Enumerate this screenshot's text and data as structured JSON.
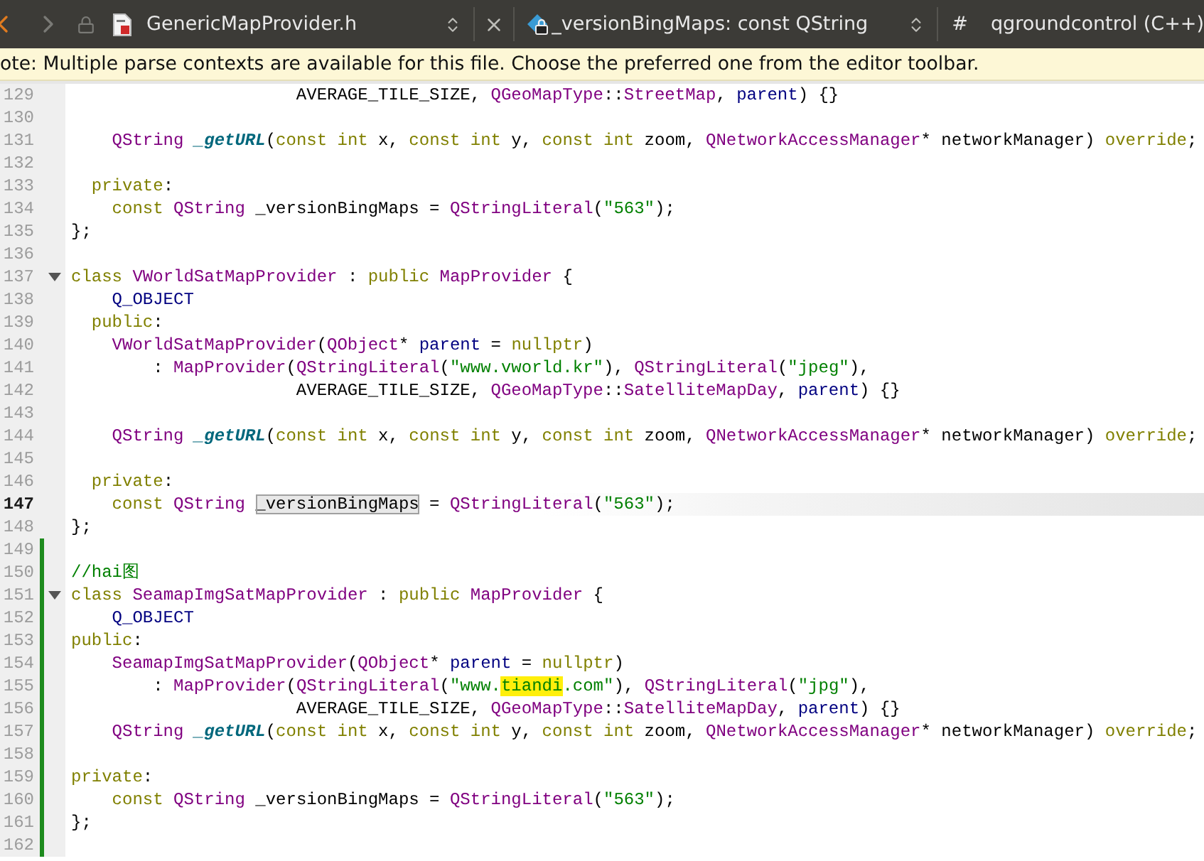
{
  "toolbar": {
    "file_name": "GenericMapProvider.h",
    "symbol": "_versionBingMaps: const QString",
    "project_marker": "#",
    "project": "qgroundcontrol (C++)"
  },
  "notice": "ote: Multiple parse contexts are available for this file. Choose the preferred one from the editor toolbar.",
  "lines": [
    {
      "number": "129",
      "current": false,
      "changed": false,
      "foldable": false,
      "tokens": [
        {
          "kind": "plain",
          "text": "                      AVERAGE_TILE_SIZE, "
        },
        {
          "kind": "type",
          "text": "QGeoMapType"
        },
        {
          "kind": "plain",
          "text": "::"
        },
        {
          "kind": "type",
          "text": "StreetMap"
        },
        {
          "kind": "plain",
          "text": ", "
        },
        {
          "kind": "member",
          "text": "parent"
        },
        {
          "kind": "plain",
          "text": ") {}"
        }
      ]
    },
    {
      "number": "130",
      "current": false,
      "changed": false,
      "foldable": false
    },
    {
      "number": "131",
      "current": false,
      "changed": false,
      "foldable": false,
      "tokens": [
        {
          "kind": "type",
          "text": "    QString "
        },
        {
          "kind": "fn",
          "text": "_getURL"
        },
        {
          "kind": "plain",
          "text": "("
        },
        {
          "kind": "kw",
          "text": "const int"
        },
        {
          "kind": "plain",
          "text": " x, "
        },
        {
          "kind": "kw",
          "text": "const int"
        },
        {
          "kind": "plain",
          "text": " y, "
        },
        {
          "kind": "kw",
          "text": "const int"
        },
        {
          "kind": "plain",
          "text": " zoom, "
        },
        {
          "kind": "type",
          "text": "QNetworkAccessManager"
        },
        {
          "kind": "plain",
          "text": "* networkManager) "
        },
        {
          "kind": "kw",
          "text": "override"
        },
        {
          "kind": "plain",
          "text": ";"
        }
      ]
    },
    {
      "number": "132",
      "current": false,
      "changed": false,
      "foldable": false
    },
    {
      "number": "133",
      "current": false,
      "changed": false,
      "foldable": false,
      "tokens": [
        {
          "kind": "kw",
          "text": "  private"
        },
        {
          "kind": "plain",
          "text": ":"
        }
      ]
    },
    {
      "number": "134",
      "current": false,
      "changed": false,
      "foldable": false,
      "tokens": [
        {
          "kind": "kw",
          "text": "    const "
        },
        {
          "kind": "type",
          "text": "QString"
        },
        {
          "kind": "plain",
          "text": " _versionBingMaps = "
        },
        {
          "kind": "type",
          "text": "QStringLiteral"
        },
        {
          "kind": "plain",
          "text": "("
        },
        {
          "kind": "str",
          "text": "\"563\""
        },
        {
          "kind": "plain",
          "text": ");"
        }
      ]
    },
    {
      "number": "135",
      "current": false,
      "changed": false,
      "foldable": false,
      "tokens": [
        {
          "kind": "plain",
          "text": "};"
        }
      ]
    },
    {
      "number": "136",
      "current": false,
      "changed": false,
      "foldable": false
    },
    {
      "number": "137",
      "current": false,
      "changed": false,
      "foldable": true,
      "tokens": [
        {
          "kind": "kw",
          "text": "class "
        },
        {
          "kind": "type",
          "text": "VWorldSatMapProvider"
        },
        {
          "kind": "plain",
          "text": " : "
        },
        {
          "kind": "kw",
          "text": "public "
        },
        {
          "kind": "type",
          "text": "MapProvider"
        },
        {
          "kind": "plain",
          "text": " {"
        }
      ]
    },
    {
      "number": "138",
      "current": false,
      "changed": false,
      "foldable": false,
      "tokens": [
        {
          "kind": "member",
          "text": "    Q_OBJECT"
        }
      ]
    },
    {
      "number": "139",
      "current": false,
      "changed": false,
      "foldable": false,
      "tokens": [
        {
          "kind": "kw",
          "text": "  public"
        },
        {
          "kind": "plain",
          "text": ":"
        }
      ]
    },
    {
      "number": "140",
      "current": false,
      "changed": false,
      "foldable": false,
      "tokens": [
        {
          "kind": "type",
          "text": "    VWorldSatMapProvider"
        },
        {
          "kind": "plain",
          "text": "("
        },
        {
          "kind": "type",
          "text": "QObject"
        },
        {
          "kind": "plain",
          "text": "* "
        },
        {
          "kind": "member",
          "text": "parent"
        },
        {
          "kind": "plain",
          "text": " = "
        },
        {
          "kind": "kw",
          "text": "nullptr"
        },
        {
          "kind": "plain",
          "text": ")"
        }
      ]
    },
    {
      "number": "141",
      "current": false,
      "changed": false,
      "foldable": false,
      "tokens": [
        {
          "kind": "plain",
          "text": "        : "
        },
        {
          "kind": "type",
          "text": "MapProvider"
        },
        {
          "kind": "plain",
          "text": "("
        },
        {
          "kind": "type",
          "text": "QStringLiteral"
        },
        {
          "kind": "plain",
          "text": "("
        },
        {
          "kind": "str",
          "text": "\"www.vworld.kr\""
        },
        {
          "kind": "plain",
          "text": "), "
        },
        {
          "kind": "type",
          "text": "QStringLiteral"
        },
        {
          "kind": "plain",
          "text": "("
        },
        {
          "kind": "str",
          "text": "\"jpeg\""
        },
        {
          "kind": "plain",
          "text": "),"
        }
      ]
    },
    {
      "number": "142",
      "current": false,
      "changed": false,
      "foldable": false,
      "tokens": [
        {
          "kind": "plain",
          "text": "                      AVERAGE_TILE_SIZE, "
        },
        {
          "kind": "type",
          "text": "QGeoMapType"
        },
        {
          "kind": "plain",
          "text": "::"
        },
        {
          "kind": "type",
          "text": "SatelliteMapDay"
        },
        {
          "kind": "plain",
          "text": ", "
        },
        {
          "kind": "member",
          "text": "parent"
        },
        {
          "kind": "plain",
          "text": ") {}"
        }
      ]
    },
    {
      "number": "143",
      "current": false,
      "changed": false,
      "foldable": false
    },
    {
      "number": "144",
      "current": false,
      "changed": false,
      "foldable": false,
      "tokens": [
        {
          "kind": "type",
          "text": "    QString "
        },
        {
          "kind": "fn",
          "text": "_getURL"
        },
        {
          "kind": "plain",
          "text": "("
        },
        {
          "kind": "kw",
          "text": "const int"
        },
        {
          "kind": "plain",
          "text": " x, "
        },
        {
          "kind": "kw",
          "text": "const int"
        },
        {
          "kind": "plain",
          "text": " y, "
        },
        {
          "kind": "kw",
          "text": "const int"
        },
        {
          "kind": "plain",
          "text": " zoom, "
        },
        {
          "kind": "type",
          "text": "QNetworkAccessManager"
        },
        {
          "kind": "plain",
          "text": "* networkManager) "
        },
        {
          "kind": "kw",
          "text": "override"
        },
        {
          "kind": "plain",
          "text": ";"
        }
      ]
    },
    {
      "number": "145",
      "current": false,
      "changed": false,
      "foldable": false
    },
    {
      "number": "146",
      "current": false,
      "changed": false,
      "foldable": false,
      "tokens": [
        {
          "kind": "kw",
          "text": "  private"
        },
        {
          "kind": "plain",
          "text": ":"
        }
      ]
    },
    {
      "number": "147",
      "current": true,
      "changed": false,
      "foldable": false,
      "tokens": [
        {
          "kind": "kw",
          "text": "    const "
        },
        {
          "kind": "type",
          "text": "QString "
        },
        {
          "kind": "ref",
          "text": "_versionBingMaps"
        },
        {
          "kind": "plain",
          "text": " = "
        },
        {
          "kind": "type",
          "text": "QStringLiteral"
        },
        {
          "kind": "plain",
          "text": "("
        },
        {
          "kind": "str",
          "text": "\"563\""
        },
        {
          "kind": "plain",
          "text": ");"
        }
      ]
    },
    {
      "number": "148",
      "current": false,
      "changed": false,
      "foldable": false,
      "tokens": [
        {
          "kind": "plain",
          "text": "};"
        }
      ]
    },
    {
      "number": "149",
      "current": false,
      "changed": true,
      "foldable": false
    },
    {
      "number": "150",
      "current": false,
      "changed": true,
      "foldable": false,
      "tokens": [
        {
          "kind": "cmt",
          "text": "//hai图"
        }
      ]
    },
    {
      "number": "151",
      "current": false,
      "changed": true,
      "foldable": true,
      "tokens": [
        {
          "kind": "kw",
          "text": "class "
        },
        {
          "kind": "type",
          "text": "SeamapImgSatMapProvider"
        },
        {
          "kind": "plain",
          "text": " : "
        },
        {
          "kind": "kw",
          "text": "public "
        },
        {
          "kind": "type",
          "text": "MapProvider"
        },
        {
          "kind": "plain",
          "text": " {"
        }
      ]
    },
    {
      "number": "152",
      "current": false,
      "changed": true,
      "foldable": false,
      "tokens": [
        {
          "kind": "member",
          "text": "    Q_OBJECT"
        }
      ]
    },
    {
      "number": "153",
      "current": false,
      "changed": true,
      "foldable": false,
      "tokens": [
        {
          "kind": "kw",
          "text": "public"
        },
        {
          "kind": "plain",
          "text": ":"
        }
      ]
    },
    {
      "number": "154",
      "current": false,
      "changed": true,
      "foldable": false,
      "tokens": [
        {
          "kind": "type",
          "text": "    SeamapImgSatMapProvider"
        },
        {
          "kind": "plain",
          "text": "("
        },
        {
          "kind": "type",
          "text": "QObject"
        },
        {
          "kind": "plain",
          "text": "* "
        },
        {
          "kind": "member",
          "text": "parent"
        },
        {
          "kind": "plain",
          "text": " = "
        },
        {
          "kind": "kw",
          "text": "nullptr"
        },
        {
          "kind": "plain",
          "text": ")"
        }
      ]
    },
    {
      "number": "155",
      "current": false,
      "changed": true,
      "foldable": false,
      "tokens": [
        {
          "kind": "plain",
          "text": "        : "
        },
        {
          "kind": "type",
          "text": "MapProvider"
        },
        {
          "kind": "plain",
          "text": "("
        },
        {
          "kind": "type",
          "text": "QStringLiteral"
        },
        {
          "kind": "plain",
          "text": "("
        },
        {
          "kind": "str",
          "text": "\"www."
        },
        {
          "kind": "match",
          "text": "tiandi"
        },
        {
          "kind": "str",
          "text": ".com\""
        },
        {
          "kind": "plain",
          "text": "), "
        },
        {
          "kind": "type",
          "text": "QStringLiteral"
        },
        {
          "kind": "plain",
          "text": "("
        },
        {
          "kind": "str",
          "text": "\"jpg\""
        },
        {
          "kind": "plain",
          "text": "),"
        }
      ]
    },
    {
      "number": "156",
      "current": false,
      "changed": true,
      "foldable": false,
      "tokens": [
        {
          "kind": "plain",
          "text": "                      AVERAGE_TILE_SIZE, "
        },
        {
          "kind": "type",
          "text": "QGeoMapType"
        },
        {
          "kind": "plain",
          "text": "::"
        },
        {
          "kind": "type",
          "text": "SatelliteMapDay"
        },
        {
          "kind": "plain",
          "text": ", "
        },
        {
          "kind": "member",
          "text": "parent"
        },
        {
          "kind": "plain",
          "text": ") {}"
        }
      ]
    },
    {
      "number": "157",
      "current": false,
      "changed": true,
      "foldable": false,
      "tokens": [
        {
          "kind": "type",
          "text": "    QString "
        },
        {
          "kind": "fn",
          "text": "_getURL"
        },
        {
          "kind": "plain",
          "text": "("
        },
        {
          "kind": "kw",
          "text": "const int"
        },
        {
          "kind": "plain",
          "text": " x, "
        },
        {
          "kind": "kw",
          "text": "const int"
        },
        {
          "kind": "plain",
          "text": " y, "
        },
        {
          "kind": "kw",
          "text": "const int"
        },
        {
          "kind": "plain",
          "text": " zoom, "
        },
        {
          "kind": "type",
          "text": "QNetworkAccessManager"
        },
        {
          "kind": "plain",
          "text": "* networkManager) "
        },
        {
          "kind": "kw",
          "text": "override"
        },
        {
          "kind": "plain",
          "text": ";"
        }
      ]
    },
    {
      "number": "158",
      "current": false,
      "changed": true,
      "foldable": false
    },
    {
      "number": "159",
      "current": false,
      "changed": true,
      "foldable": false,
      "tokens": [
        {
          "kind": "kw",
          "text": "private"
        },
        {
          "kind": "plain",
          "text": ":"
        }
      ]
    },
    {
      "number": "160",
      "current": false,
      "changed": true,
      "foldable": false,
      "tokens": [
        {
          "kind": "kw",
          "text": "    const "
        },
        {
          "kind": "type",
          "text": "QString"
        },
        {
          "kind": "plain",
          "text": " _versionBingMaps = "
        },
        {
          "kind": "type",
          "text": "QStringLiteral"
        },
        {
          "kind": "plain",
          "text": "("
        },
        {
          "kind": "str",
          "text": "\"563\""
        },
        {
          "kind": "plain",
          "text": ");"
        }
      ]
    },
    {
      "number": "161",
      "current": false,
      "changed": true,
      "foldable": false,
      "tokens": [
        {
          "kind": "plain",
          "text": "};"
        }
      ]
    },
    {
      "number": "162",
      "current": false,
      "changed": true,
      "foldable": false
    }
  ]
}
